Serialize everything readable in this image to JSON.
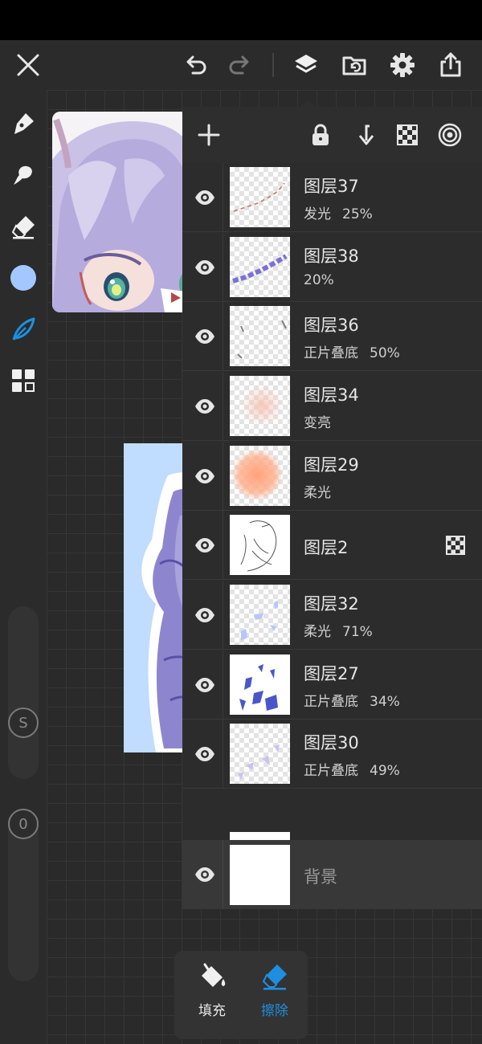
{
  "colors": {
    "accent": "#1e8fe0",
    "current_color": "#a3c8ff",
    "panel_bg": "#2c2c2c",
    "text_primary": "#e6e6e6"
  },
  "toolbar": {
    "icons": [
      "close-icon",
      "undo-icon",
      "redo-icon",
      "layers-icon",
      "import-icon",
      "gear-icon",
      "share-icon"
    ]
  },
  "left_tools": {
    "icons": [
      "pen-icon",
      "smudge-icon",
      "eraser-icon",
      "color-swatch",
      "feather-icon",
      "grid-icon"
    ],
    "size_slider_label": "S",
    "opacity_slider_label": "0"
  },
  "layer_panel": {
    "header_icons": [
      "add-icon",
      "lock-icon",
      "merge-down-icon",
      "checkerboard-icon",
      "radial-icon"
    ],
    "layers": [
      {
        "name": "图层37",
        "mode": "发光",
        "opacity": "25%"
      },
      {
        "name": "图层38",
        "mode": "",
        "opacity": "20%"
      },
      {
        "name": "图层36",
        "mode": "正片叠底",
        "opacity": "50%"
      },
      {
        "name": "图层34",
        "mode": "变亮",
        "opacity": ""
      },
      {
        "name": "图层29",
        "mode": "柔光",
        "opacity": ""
      },
      {
        "name": "图层2",
        "mode": "",
        "opacity": ""
      },
      {
        "name": "图层32",
        "mode": "柔光",
        "opacity": "71%"
      },
      {
        "name": "图层27",
        "mode": "正片叠底",
        "opacity": "34%"
      },
      {
        "name": "图层30",
        "mode": "正片叠底",
        "opacity": "49%"
      }
    ],
    "background_layer": {
      "name": "背景"
    }
  },
  "tool_card": {
    "fill_label": "填充",
    "erase_label": "擦除"
  }
}
